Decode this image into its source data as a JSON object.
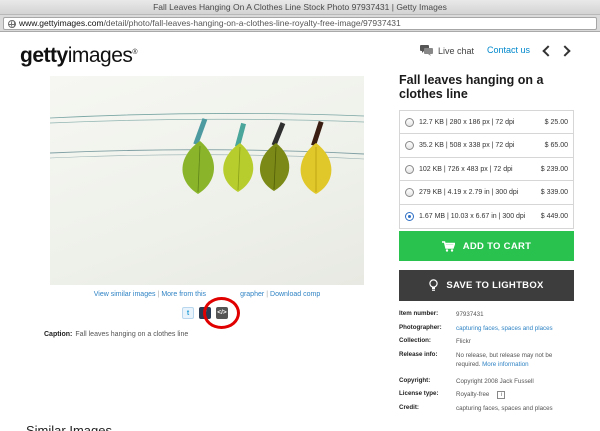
{
  "browser": {
    "window_title": "Fall Leaves Hanging On A Clothes Line Stock Photo 97937431 | Getty Images",
    "url_host": "www.gettyimages.com",
    "url_path": "/detail/photo/fall-leaves-hanging-on-a-clothes-line-royalty-free-image/97937431"
  },
  "header": {
    "logo_bold": "getty",
    "logo_light": "images",
    "logo_mark": "®",
    "live_chat": "Live chat",
    "contact": "Contact us"
  },
  "photo": {
    "links": [
      "View similar images",
      "More from this photographer",
      "Download comp"
    ],
    "links_visible": [
      "View similar images",
      "More from this",
      "grapher",
      "Download comp"
    ],
    "caption_label": "Caption:",
    "caption_text": "Fall leaves hanging on a clothes line",
    "share": {
      "twitter": "t",
      "facebook": "f",
      "embed": "</>"
    }
  },
  "related_heading": "Similar Images",
  "title": "Fall leaves hanging on a clothes line",
  "sizes": [
    {
      "spec": "12.7 KB  |  280 x 186 px  |  72 dpi",
      "price": "$ 25.00",
      "selected": false
    },
    {
      "spec": "35.2 KB  |  508 x 338 px  |  72 dpi",
      "price": "$ 65.00",
      "selected": false
    },
    {
      "spec": "102 KB  |  726 x 483 px  |  72 dpi",
      "price": "$ 239.00",
      "selected": false
    },
    {
      "spec": "279 KB  |  4.19 x 2.79 in  |  300 dpi",
      "price": "$ 339.00",
      "selected": false
    },
    {
      "spec": "1.67 MB  |  10.03 x 6.67 in  |  300 dpi",
      "price": "$ 449.00",
      "selected": true
    }
  ],
  "buttons": {
    "cart": "ADD TO CART",
    "lightbox": "SAVE TO LIGHTBOX"
  },
  "details": {
    "item_number_label": "Item number:",
    "item_number": "97937431",
    "photographer_label": "Photographer:",
    "photographer": "capturing faces, spaces and places",
    "collection_label": "Collection:",
    "collection": "Flickr",
    "release_label": "Release info:",
    "release": "No release, but release may not be required.",
    "release_more": "More information",
    "copyright_label": "Copyright:",
    "copyright": "Copyright 2008 Jack Fussell",
    "license_label": "License type:",
    "license": "Royalty-free",
    "license_info": "i",
    "credit_label": "Credit:",
    "credit": "capturing faces, spaces and places"
  },
  "colors": {
    "link": "#2f83c4",
    "cart_green": "#29c24f",
    "lightbox_dark": "#3d3d3d",
    "highlight_circle": "#e00000"
  },
  "icons": {
    "live_chat": "chat-bubble-icon",
    "cart": "shopping-cart-icon",
    "lightbox": "lightbulb-icon"
  }
}
